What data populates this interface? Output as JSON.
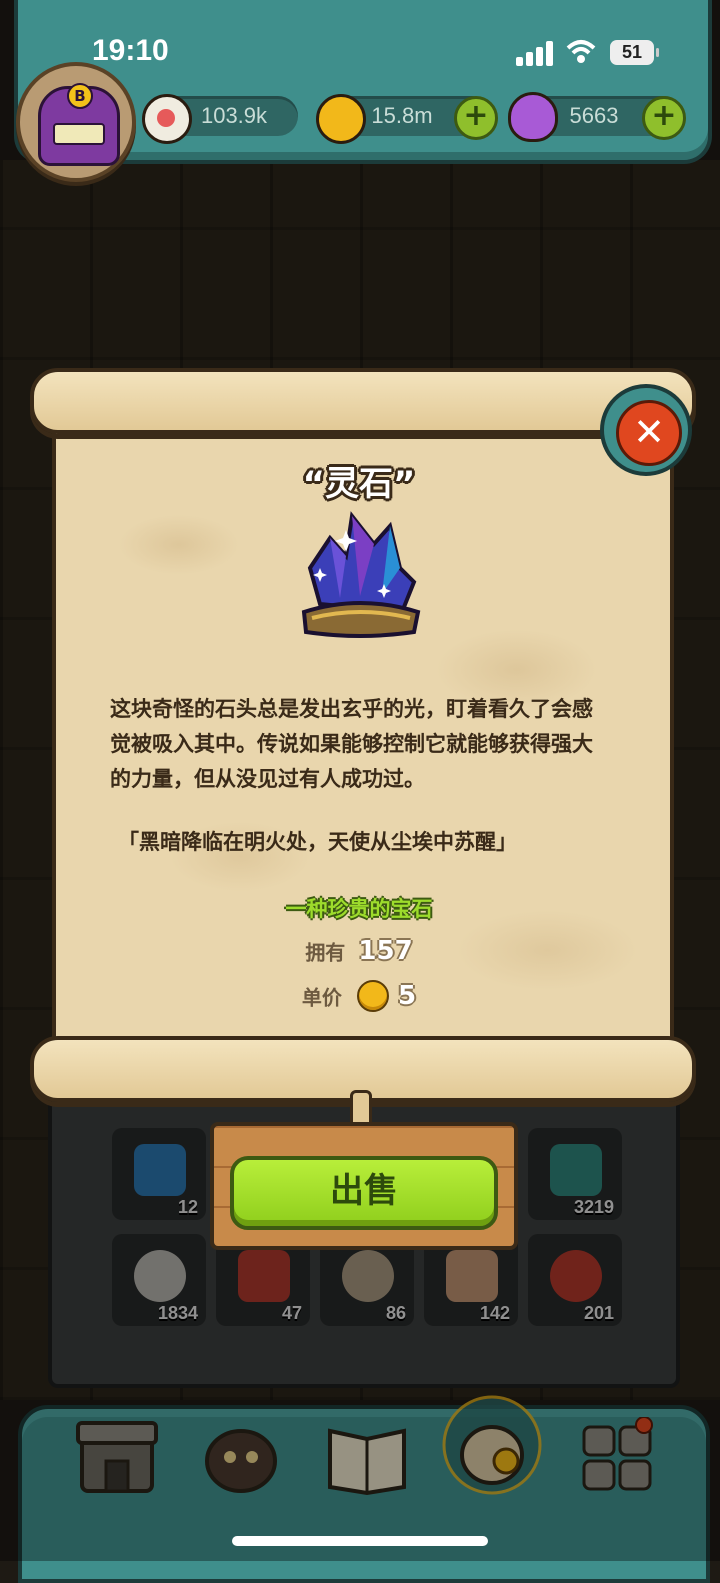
{
  "status_bar": {
    "time": "19:10",
    "battery": "51"
  },
  "resources": [
    {
      "name": "eyeball",
      "value": "103.9k",
      "color": "#e65a5a"
    },
    {
      "name": "coin",
      "value": "15.8m",
      "color": "#f2b81a"
    },
    {
      "name": "potion",
      "value": "5663",
      "color": "#a85ad6"
    }
  ],
  "avatar": {
    "letter": "B"
  },
  "item": {
    "title": "“灵石”",
    "description": "这块奇怪的石头总是发出玄乎的光，盯着看久了会感觉被吸入其中。传说如果能够控制它就能够获得强大的力量，但从没见过有人成功过。",
    "quote": "「黑暗降临在明火处，天使从尘埃中苏醒」",
    "category": "一种珍贵的宝石",
    "owned_label": "拥有",
    "owned_value": "157",
    "price_label": "单价",
    "price_value": "5"
  },
  "sell_button": "出售",
  "inventory_counts": [
    "12",
    "3219",
    "1834",
    "47",
    "86",
    "142",
    "201"
  ],
  "bottom_nav": [
    "shop",
    "monster",
    "book",
    "inventory-bag",
    "more"
  ]
}
